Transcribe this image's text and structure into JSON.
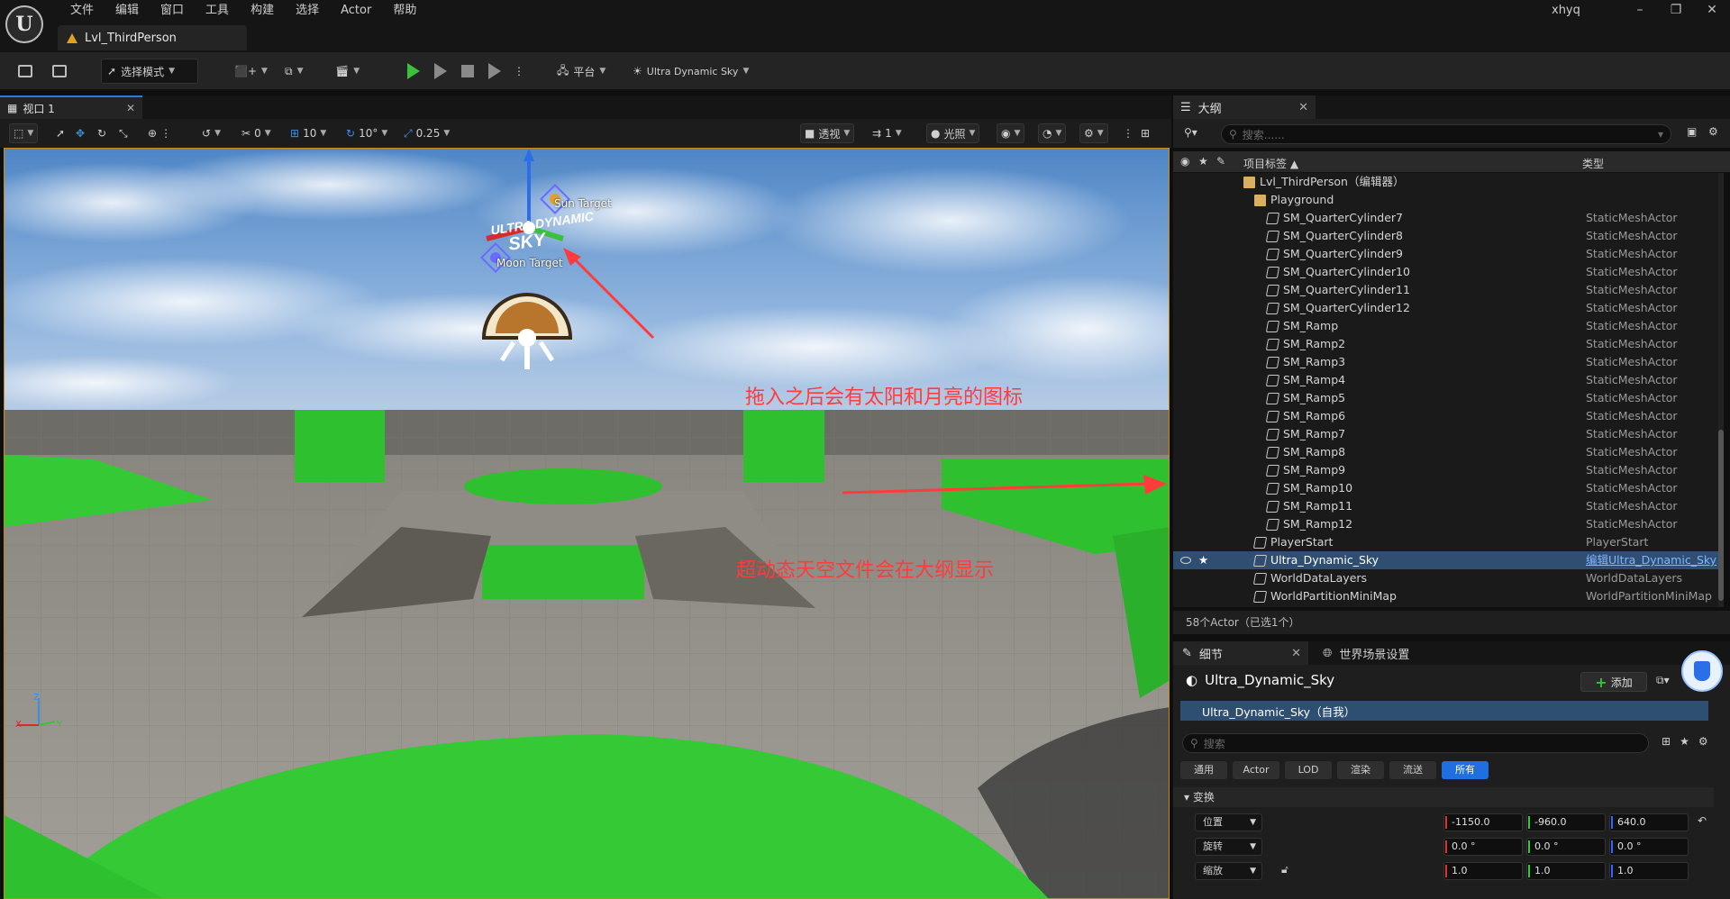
{
  "menu": {
    "items": [
      "文件",
      "编辑",
      "窗口",
      "工具",
      "构建",
      "选择",
      "Actor",
      "帮助"
    ],
    "user": "xhyq"
  },
  "document_tab": "Lvl_ThirdPerson",
  "toolbar": {
    "mode": "选择模式",
    "platform": "平台",
    "sky_plugin": "Ultra Dynamic Sky"
  },
  "viewport": {
    "tab": "视口 1",
    "snap_translate": "10",
    "snap_rotate": "10°",
    "snap_scale": "0.25",
    "camera_speed": "0",
    "perspective": "透视",
    "layer": "1",
    "lighting": "光照",
    "sun_target": "Sun Target",
    "moon_target": "Moon Target",
    "annotation_1": "拖入之后会有太阳和月亮的图标",
    "annotation_2": "超动态天空文件会在大纲显示",
    "axis_x": "X",
    "axis_y": "Y",
    "axis_z": "Z",
    "logo_line1": "ULTRA DYNAMIC",
    "logo_line2": "SKY"
  },
  "outliner": {
    "tab": "大纲",
    "search_placeholder": "搜索......",
    "col_label": "项目标签 ▲",
    "col_type": "类型",
    "rows": [
      {
        "name": "Lvl_ThirdPerson（编辑器）",
        "type": ""
      },
      {
        "name": "Playground",
        "type": ""
      },
      {
        "name": "SM_QuarterCylinder7",
        "type": "StaticMeshActor"
      },
      {
        "name": "SM_QuarterCylinder8",
        "type": "StaticMeshActor"
      },
      {
        "name": "SM_QuarterCylinder9",
        "type": "StaticMeshActor"
      },
      {
        "name": "SM_QuarterCylinder10",
        "type": "StaticMeshActor"
      },
      {
        "name": "SM_QuarterCylinder11",
        "type": "StaticMeshActor"
      },
      {
        "name": "SM_QuarterCylinder12",
        "type": "StaticMeshActor"
      },
      {
        "name": "SM_Ramp",
        "type": "StaticMeshActor"
      },
      {
        "name": "SM_Ramp2",
        "type": "StaticMeshActor"
      },
      {
        "name": "SM_Ramp3",
        "type": "StaticMeshActor"
      },
      {
        "name": "SM_Ramp4",
        "type": "StaticMeshActor"
      },
      {
        "name": "SM_Ramp5",
        "type": "StaticMeshActor"
      },
      {
        "name": "SM_Ramp6",
        "type": "StaticMeshActor"
      },
      {
        "name": "SM_Ramp7",
        "type": "StaticMeshActor"
      },
      {
        "name": "SM_Ramp8",
        "type": "StaticMeshActor"
      },
      {
        "name": "SM_Ramp9",
        "type": "StaticMeshActor"
      },
      {
        "name": "SM_Ramp10",
        "type": "StaticMeshActor"
      },
      {
        "name": "SM_Ramp11",
        "type": "StaticMeshActor"
      },
      {
        "name": "SM_Ramp12",
        "type": "StaticMeshActor"
      },
      {
        "name": "PlayerStart",
        "type": "PlayerStart"
      },
      {
        "name": "Ultra_Dynamic_Sky",
        "type": "编辑Ultra_Dynamic_Sky"
      },
      {
        "name": "WorldDataLayers",
        "type": "WorldDataLayers"
      },
      {
        "name": "WorldPartitionMiniMap",
        "type": "WorldPartitionMiniMap"
      }
    ],
    "footer": "58个Actor（已选1个）"
  },
  "details": {
    "tab": "细节",
    "tab2": "世界场景设置",
    "actor_name": "Ultra_Dynamic_Sky",
    "add_label": "添加",
    "self_label": "Ultra_Dynamic_Sky（自我）",
    "search_placeholder": "搜索",
    "filters": [
      "通用",
      "Actor",
      "LOD",
      "渲染",
      "流送",
      "所有"
    ],
    "section": "变换",
    "location": {
      "label": "位置",
      "x": "-1150.0",
      "y": "-960.0",
      "z": "640.0"
    },
    "rotation": {
      "label": "旋转",
      "x": "0.0 °",
      "y": "0.0 °",
      "z": "0.0 °"
    },
    "scale": {
      "label": "缩放",
      "x": "1.0",
      "y": "1.0",
      "z": "1.0"
    }
  },
  "colors": {
    "accent": "#2d7bd6",
    "selection": "#2e4e72",
    "annotation": "#ff3b3b",
    "play": "#3cbf3c",
    "ground_green": "#2fc02f"
  }
}
